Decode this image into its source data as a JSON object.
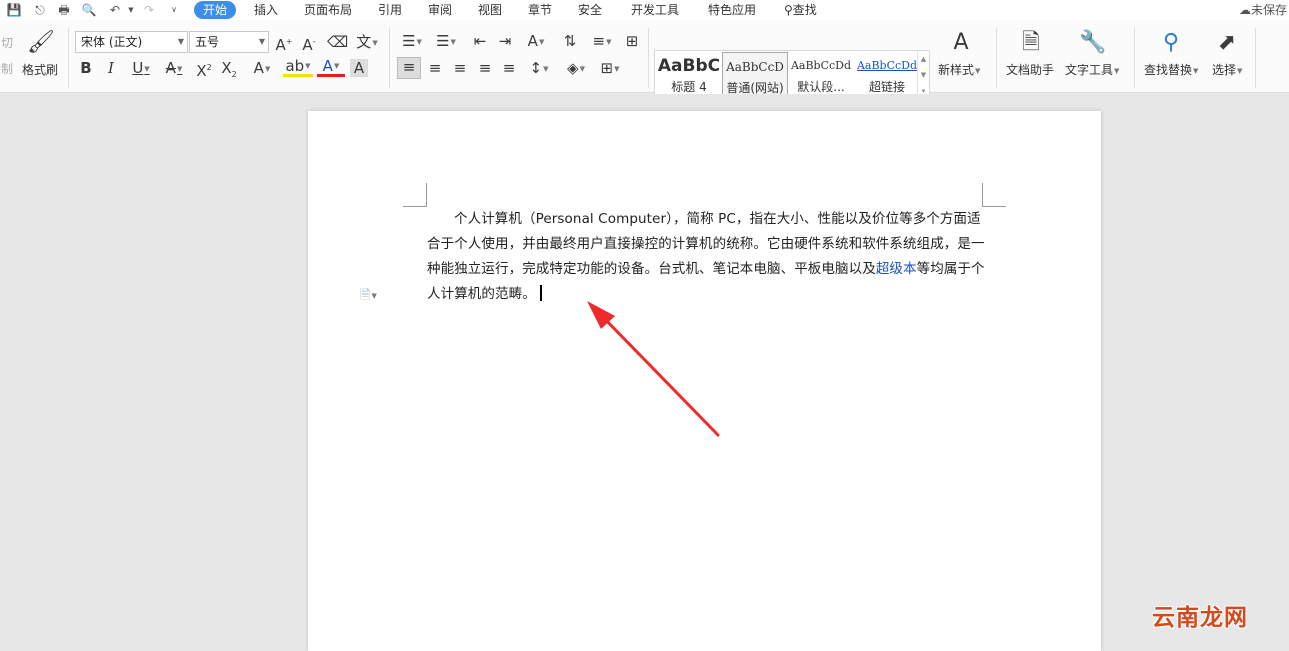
{
  "topbar": {
    "menus": [
      "开始",
      "插入",
      "页面布局",
      "引用",
      "审阅",
      "视图",
      "章节",
      "安全",
      "开发工具",
      "特色应用"
    ],
    "search_label": "查找",
    "status": "未保存"
  },
  "ribbon": {
    "cut_label": "切",
    "cut_label2": "制",
    "format_painter_label": "格式刷",
    "font_name": "宋体 (正文)",
    "font_size": "五号",
    "styles": [
      {
        "sample": "AaBbC",
        "name": "标题 4"
      },
      {
        "sample": "AaBbCcD",
        "name": "普通(网站)"
      },
      {
        "sample": "AaBbCcDd",
        "name": "默认段..."
      },
      {
        "sample": "AaBbCcDd",
        "name": "超链接"
      }
    ],
    "new_style_label": "新样式",
    "doc_helper_label": "文档助手",
    "text_tools_label": "文字工具",
    "find_replace_label": "查找替换",
    "select_label": "选择"
  },
  "document": {
    "text_part1": "个人计算机（Personal Computer），简称 PC，指在大小、性能以及价位等多个方面适合于个人使用，并由最终用户直接操控的计算机的统称。它由硬件系统和软件系统组成，是一种能独立运行，完成特定功能的设备。台式机、笔记本电脑、平板电脑以及",
    "link_text": "超级本",
    "text_part2": "等均属于个人计算机的范畴。"
  },
  "watermark": "云南龙网",
  "colors": {
    "accent": "#3c8ee8",
    "arrow": "#f02a2a",
    "link": "#1f4fbf",
    "watermark": "#d34a1f"
  }
}
